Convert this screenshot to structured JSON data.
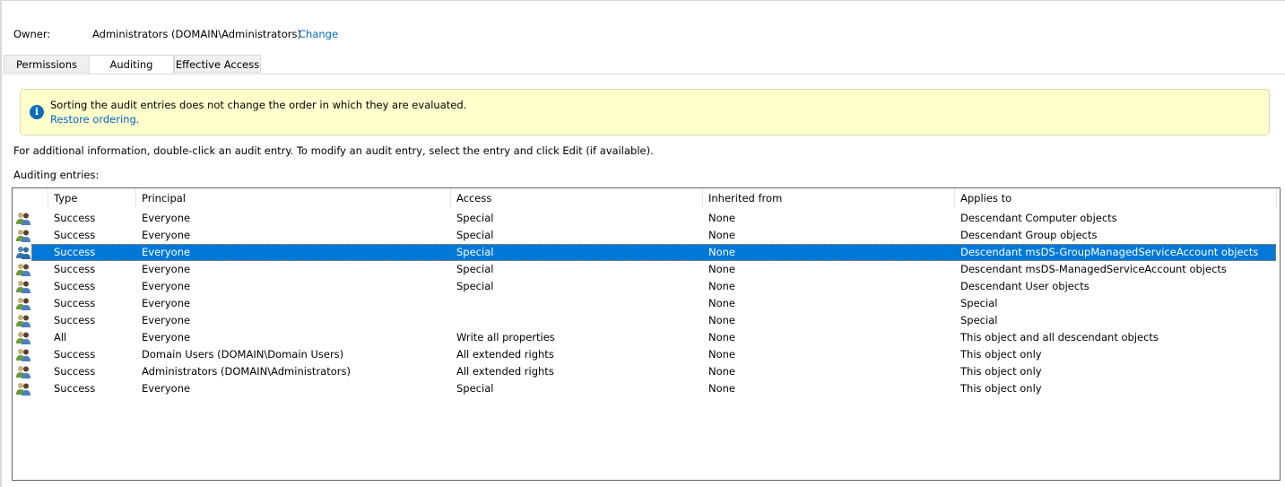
{
  "owner": {
    "label": "Owner:",
    "value": "Administrators (DOMAIN\\Administrators)",
    "change_link": "Change"
  },
  "tabs": [
    {
      "label": "Permissions",
      "active": false
    },
    {
      "label": "Auditing",
      "active": true
    },
    {
      "label": "Effective Access",
      "active": false
    }
  ],
  "info_bar": {
    "icon": "info-icon",
    "message": "Sorting the audit entries does not change the order in which they are evaluated.",
    "link": "Restore ordering."
  },
  "help_text": "For additional information, double-click an audit entry. To modify an audit entry, select the entry and click Edit (if available).",
  "entries_label": "Auditing entries:",
  "table": {
    "columns": [
      "Type",
      "Principal",
      "Access",
      "Inherited from",
      "Applies to"
    ],
    "selected_index": 2,
    "rows": [
      {
        "icon": "users-group-icon",
        "type": "Success",
        "principal": "Everyone",
        "access": "Special",
        "inherited": "None",
        "applies": "Descendant Computer objects"
      },
      {
        "icon": "users-group-icon",
        "type": "Success",
        "principal": "Everyone",
        "access": "Special",
        "inherited": "None",
        "applies": "Descendant Group objects"
      },
      {
        "icon": "users-group-icon",
        "type": "Success",
        "principal": "Everyone",
        "access": "Special",
        "inherited": "None",
        "applies": "Descendant msDS-GroupManagedServiceAccount objects"
      },
      {
        "icon": "users-group-icon",
        "type": "Success",
        "principal": "Everyone",
        "access": "Special",
        "inherited": "None",
        "applies": "Descendant msDS-ManagedServiceAccount objects"
      },
      {
        "icon": "users-group-icon",
        "type": "Success",
        "principal": "Everyone",
        "access": "Special",
        "inherited": "None",
        "applies": "Descendant User objects"
      },
      {
        "icon": "users-group-icon",
        "type": "Success",
        "principal": "Everyone",
        "access": "",
        "inherited": "None",
        "applies": "Special"
      },
      {
        "icon": "users-group-icon",
        "type": "Success",
        "principal": "Everyone",
        "access": "",
        "inherited": "None",
        "applies": "Special"
      },
      {
        "icon": "users-group-icon",
        "type": "All",
        "principal": "Everyone",
        "access": "Write all properties",
        "inherited": "None",
        "applies": "This object and all descendant objects"
      },
      {
        "icon": "users-group-icon",
        "type": "Success",
        "principal": "Domain Users (DOMAIN\\Domain Users)",
        "access": "All extended rights",
        "inherited": "None",
        "applies": "This object only"
      },
      {
        "icon": "users-group-icon",
        "type": "Success",
        "principal": "Administrators (DOMAIN\\Administrators)",
        "access": "All extended rights",
        "inherited": "None",
        "applies": "This object only"
      },
      {
        "icon": "users-group-icon",
        "type": "Success",
        "principal": "Everyone",
        "access": "Special",
        "inherited": "None",
        "applies": "This object only"
      }
    ]
  },
  "colors": {
    "selection": "#0078d7",
    "link": "#0066cc",
    "info_bg": "#ffffcc",
    "info_icon": "#0f6cbd"
  }
}
